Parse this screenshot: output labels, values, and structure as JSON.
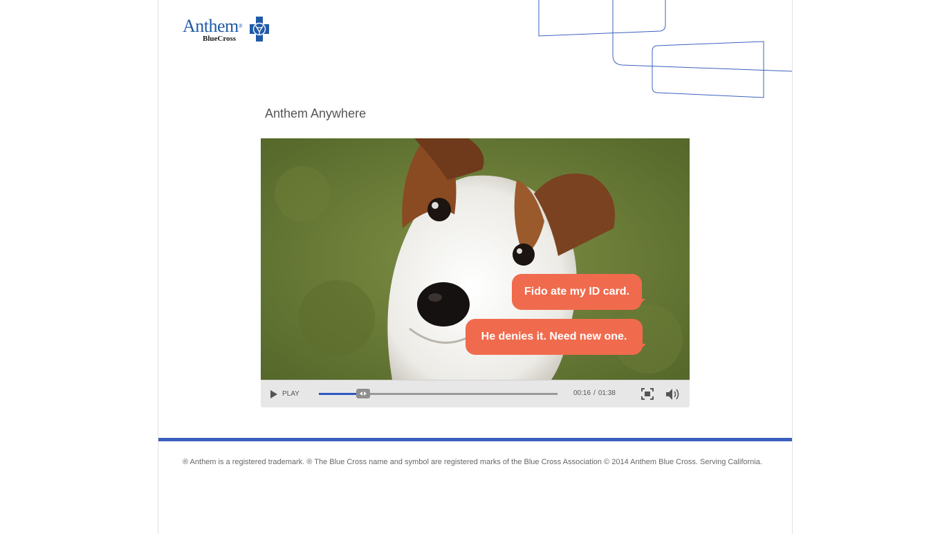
{
  "brand": {
    "name": "Anthem",
    "sub_name": "BlueCross",
    "reg_mark": "®",
    "color": "#1f5aa8"
  },
  "page": {
    "title": "Anthem Anywhere"
  },
  "video": {
    "bubbles": [
      "Fido ate my ID card.",
      "He denies it. Need new one."
    ],
    "bubble_color": "#f06b4d",
    "play_label": "PLAY",
    "current_time": "00:16",
    "time_separator": "/",
    "duration": "01:38",
    "progress_fraction": 0.163,
    "progress_color": "#2b58c0"
  },
  "accent_color": "#3b5fbf",
  "footer": {
    "text": "® Anthem is a registered trademark. ® The Blue Cross name and symbol are registered marks of the Blue Cross Association © 2014 Anthem Blue Cross. Serving California."
  }
}
